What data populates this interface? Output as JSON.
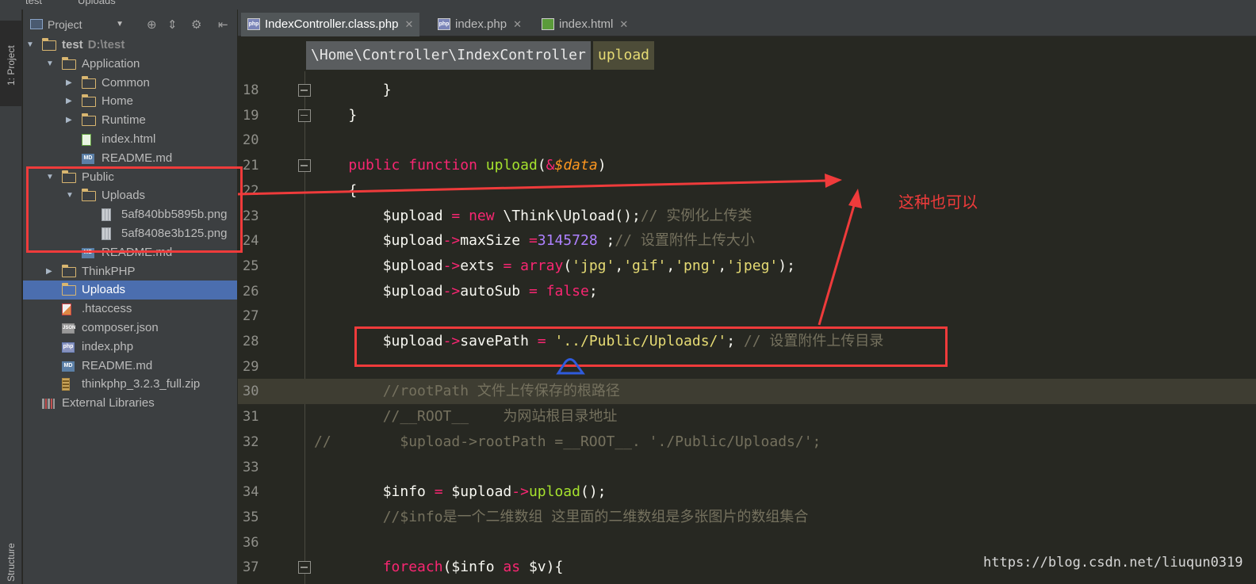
{
  "top_breadcrumb": {
    "project": "test",
    "folder": "Uploads"
  },
  "tool_stripe": {
    "project_tab": "1: Project",
    "structure_tab": "Structure"
  },
  "project_panel": {
    "selector_label": "Project",
    "tree": [
      {
        "label": "test",
        "path": "D:\\test",
        "type": "folder",
        "depth": 0,
        "expanded": true,
        "bold": true
      },
      {
        "label": "Application",
        "type": "folder",
        "depth": 1,
        "expanded": true
      },
      {
        "label": "Common",
        "type": "folder",
        "depth": 2,
        "expanded": false
      },
      {
        "label": "Home",
        "type": "folder",
        "depth": 2,
        "expanded": false
      },
      {
        "label": "Runtime",
        "type": "folder",
        "depth": 2,
        "expanded": false
      },
      {
        "label": "index.html",
        "type": "html",
        "depth": 2
      },
      {
        "label": "README.md",
        "type": "md",
        "depth": 2
      },
      {
        "label": "Public",
        "type": "folder",
        "depth": 1,
        "expanded": true
      },
      {
        "label": "Uploads",
        "type": "folder",
        "depth": 2,
        "expanded": true
      },
      {
        "label": "5af840bb5895b.png",
        "type": "png",
        "depth": 3
      },
      {
        "label": "5af8408e3b125.png",
        "type": "png",
        "depth": 3
      },
      {
        "label": "README.md",
        "type": "md",
        "depth": 2
      },
      {
        "label": "ThinkPHP",
        "type": "folder",
        "depth": 1,
        "expanded": false
      },
      {
        "label": "Uploads",
        "type": "folder",
        "depth": 1,
        "selected": true
      },
      {
        "label": ".htaccess",
        "type": "ht",
        "depth": 1
      },
      {
        "label": "composer.json",
        "type": "json",
        "depth": 1
      },
      {
        "label": "index.php",
        "type": "php",
        "depth": 1
      },
      {
        "label": "README.md",
        "type": "md",
        "depth": 1
      },
      {
        "label": "thinkphp_3.2.3_full.zip",
        "type": "zip",
        "depth": 1
      },
      {
        "label": "External Libraries",
        "type": "lib",
        "depth": 0
      }
    ]
  },
  "tabs": [
    {
      "label": "IndexController.class.php",
      "icon": "php",
      "active": true
    },
    {
      "label": "index.php",
      "icon": "php",
      "active": false
    },
    {
      "label": "index.html",
      "icon": "html",
      "active": false
    }
  ],
  "nav_breadcrumb": {
    "namespace": "\\Home\\Controller\\IndexController",
    "method": "upload"
  },
  "code_lines": [
    {
      "n": "18",
      "fold": true,
      "tokens": [
        [
          "pl",
          "        }"
        ]
      ]
    },
    {
      "n": "19",
      "fold": true,
      "tokens": [
        [
          "pl",
          "    }"
        ]
      ]
    },
    {
      "n": "20",
      "tokens": []
    },
    {
      "n": "21",
      "fold": true,
      "tokens": [
        [
          "pl",
          "    "
        ],
        [
          "kw",
          "public"
        ],
        [
          "pl",
          " "
        ],
        [
          "kw",
          "function"
        ],
        [
          "pl",
          " "
        ],
        [
          "fn",
          "upload"
        ],
        [
          "pl",
          "("
        ],
        [
          "kw",
          "&"
        ],
        [
          "vr",
          "$data"
        ],
        [
          "pl",
          ")"
        ]
      ]
    },
    {
      "n": "22",
      "tokens": [
        [
          "pl",
          "    {"
        ]
      ]
    },
    {
      "n": "23",
      "tokens": [
        [
          "pl",
          "        $upload "
        ],
        [
          "kw",
          "="
        ],
        [
          "pl",
          " "
        ],
        [
          "kw",
          "new"
        ],
        [
          "pl",
          " \\Think\\Upload();"
        ],
        [
          "cm",
          "// 实例化上传类"
        ]
      ]
    },
    {
      "n": "24",
      "tokens": [
        [
          "pl",
          "        $upload"
        ],
        [
          "kw",
          "->"
        ],
        [
          "pl",
          "maxSize "
        ],
        [
          "kw",
          "="
        ],
        [
          "nm",
          "3145728"
        ],
        [
          "pl",
          " ;"
        ],
        [
          "cm",
          "// 设置附件上传大小"
        ]
      ]
    },
    {
      "n": "25",
      "tokens": [
        [
          "pl",
          "        $upload"
        ],
        [
          "kw",
          "->"
        ],
        [
          "pl",
          "exts "
        ],
        [
          "kw",
          "="
        ],
        [
          "pl",
          " "
        ],
        [
          "kw",
          "array"
        ],
        [
          "pl",
          "("
        ],
        [
          "st",
          "'jpg'"
        ],
        [
          "pl",
          ","
        ],
        [
          "st",
          "'gif'"
        ],
        [
          "pl",
          ","
        ],
        [
          "st",
          "'png'"
        ],
        [
          "pl",
          ","
        ],
        [
          "st",
          "'jpeg'"
        ],
        [
          "pl",
          ");"
        ]
      ]
    },
    {
      "n": "26",
      "tokens": [
        [
          "pl",
          "        $upload"
        ],
        [
          "kw",
          "->"
        ],
        [
          "pl",
          "autoSub "
        ],
        [
          "kw",
          "="
        ],
        [
          "pl",
          " "
        ],
        [
          "kw",
          "false"
        ],
        [
          "pl",
          ";"
        ]
      ]
    },
    {
      "n": "27",
      "tokens": []
    },
    {
      "n": "28",
      "tokens": [
        [
          "pl",
          "        $upload"
        ],
        [
          "kw",
          "->"
        ],
        [
          "pl",
          "savePath "
        ],
        [
          "kw",
          "="
        ],
        [
          "pl",
          " "
        ],
        [
          "st",
          "'../Public/Uploads/'"
        ],
        [
          "pl",
          "; "
        ],
        [
          "cm",
          "// 设置附件上传目录"
        ]
      ]
    },
    {
      "n": "29",
      "tokens": []
    },
    {
      "n": "30",
      "hl": true,
      "tokens": [
        [
          "cm",
          "        //rootPath 文件上传保存的根路径"
        ]
      ]
    },
    {
      "n": "31",
      "tokens": [
        [
          "cm",
          "        //__ROOT__    为网站根目录地址"
        ]
      ]
    },
    {
      "n": "32",
      "tokens": [
        [
          "cm",
          "//        $upload->rootPath =__ROOT__. './Public/Uploads/';"
        ]
      ]
    },
    {
      "n": "33",
      "tokens": []
    },
    {
      "n": "34",
      "tokens": [
        [
          "pl",
          "        $info "
        ],
        [
          "kw",
          "="
        ],
        [
          "pl",
          " $upload"
        ],
        [
          "kw",
          "->"
        ],
        [
          "fn",
          "upload"
        ],
        [
          "pl",
          "();"
        ]
      ]
    },
    {
      "n": "35",
      "tokens": [
        [
          "cm",
          "        //$info是一个二维数组 这里面的二维数组是多张图片的数组集合"
        ]
      ]
    },
    {
      "n": "36",
      "tokens": []
    },
    {
      "n": "37",
      "fold": true,
      "tokens": [
        [
          "pl",
          "        "
        ],
        [
          "kw",
          "foreach"
        ],
        [
          "pl",
          "($info "
        ],
        [
          "kw",
          "as"
        ],
        [
          "pl",
          " $v){"
        ]
      ]
    }
  ],
  "annotation": {
    "note": "这种也可以"
  },
  "watermark": "https://blog.csdn.net/liuqun0319",
  "colors": {
    "bg": "#272822",
    "keyword": "#f92672",
    "function": "#a6e22e",
    "string": "#e6db74",
    "comment": "#75715e",
    "number": "#ae81ff",
    "annotation_red": "#ef3b3b",
    "selection": "#4b6eaf"
  }
}
